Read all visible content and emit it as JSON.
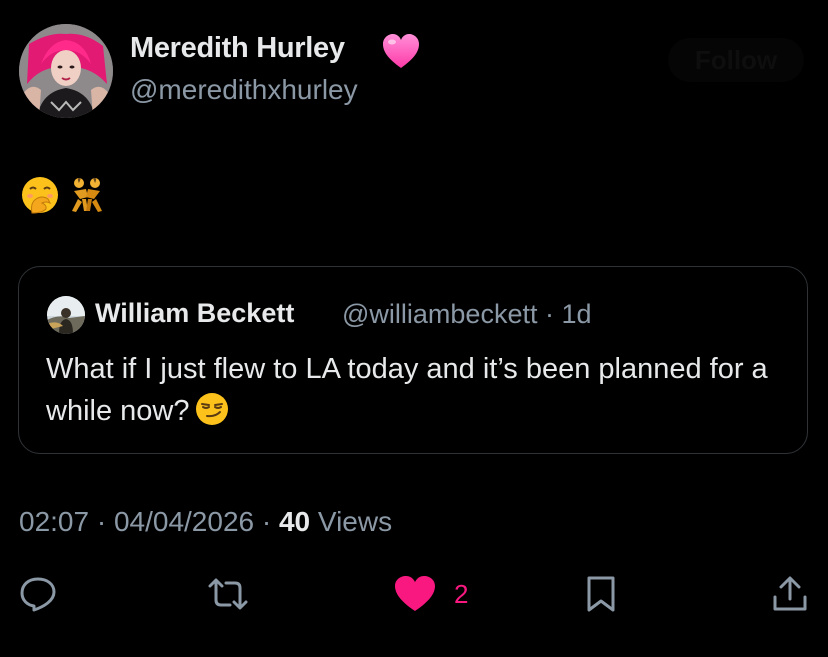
{
  "author": {
    "display_name": "Meredith Hurley",
    "name_badge_emoji": "pink-heart",
    "handle": "@meredithxhurley",
    "follow_label": "Follow"
  },
  "tweet": {
    "emojis": [
      "hand-over-mouth-face",
      "people-wrestling"
    ]
  },
  "quote": {
    "display_name": "William Beckett",
    "handle_time": "@williambeckett · 1d",
    "text": "What if I just flew to LA today and it’s been planned for a while now?",
    "trailing_emoji": "smirking-face"
  },
  "meta": {
    "timestamp": "02:07 · 04/04/2026 · ",
    "views_count": "40",
    "views_label": " Views"
  },
  "actions": {
    "like_count": "2"
  },
  "colors": {
    "background": "#000000",
    "text_primary": "#e7e9ea",
    "text_secondary": "#8b98a5",
    "border": "#2f3336",
    "like_pink": "#f91880",
    "badge_pink": "#ff4fbf"
  }
}
